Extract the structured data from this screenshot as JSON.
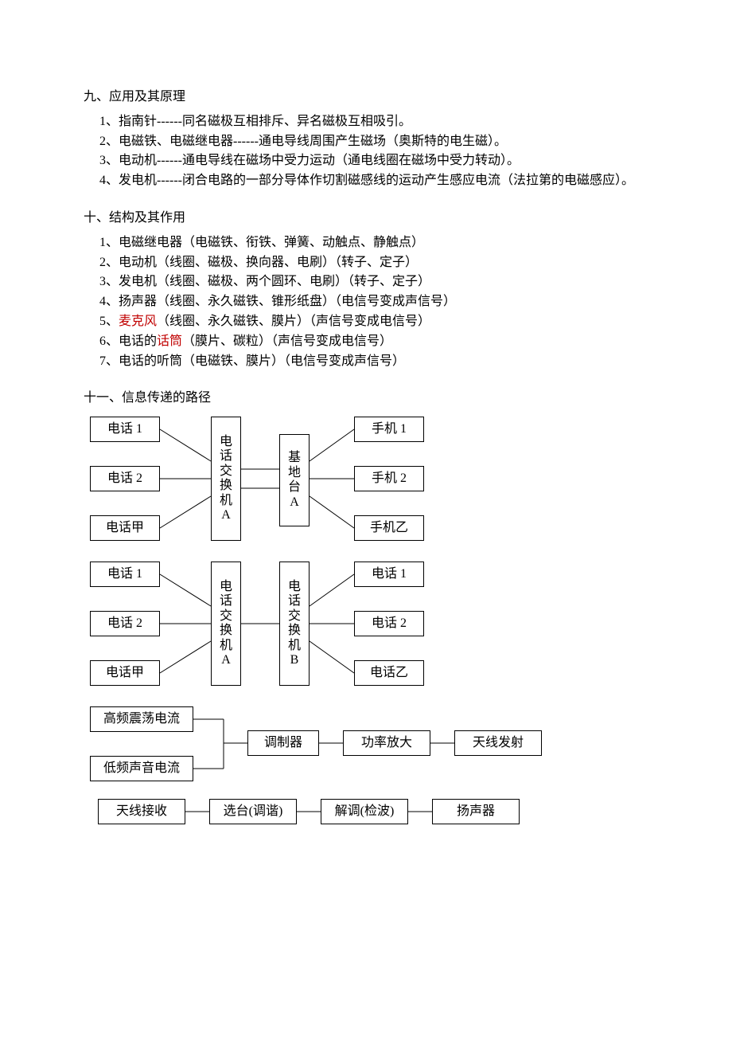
{
  "section9": {
    "title": "九、应用及其原理",
    "items": [
      "1、指南针------同名磁极互相排斥、异名磁极互相吸引。",
      "2、电磁铁、电磁继电器------通电导线周围产生磁场（奥斯特的电生磁）。",
      "3、电动机------通电导线在磁场中受力运动（通电线圈在磁场中受力转动）。",
      "4、发电机------闭合电路的一部分导体作切割磁感线的运动产生感应电流（法拉第的电磁感应）。"
    ]
  },
  "section10": {
    "title": "十、结构及其作用",
    "items": [
      {
        "pre": "1、电磁继电器（电磁铁、衔铁、弹簧、动触点、静触点）",
        "red": "",
        "post": ""
      },
      {
        "pre": "2、电动机（线圈、磁极、换向器、电刷）（转子、定子）",
        "red": "",
        "post": ""
      },
      {
        "pre": "3、发电机（线圈、磁极、两个圆环、电刷）（转子、定子）",
        "red": "",
        "post": ""
      },
      {
        "pre": "4、扬声器（线圈、永久磁铁、锥形纸盘）（电信号变成声信号）",
        "red": "",
        "post": ""
      },
      {
        "pre": "5、",
        "red": "麦克风",
        "post": "（线圈、永久磁铁、膜片）（声信号变成电信号）"
      },
      {
        "pre": "6、电话的",
        "red": "话筒",
        "post": "（膜片、碳粒）（声信号变成电信号）"
      },
      {
        "pre": "7、电话的听筒（电磁铁、膜片）（电信号变成声信号）",
        "red": "",
        "post": ""
      }
    ]
  },
  "section11": {
    "title": "十一、信息传递的路径"
  },
  "dg1": {
    "left": [
      "电话 1",
      "电话 2",
      "电话甲"
    ],
    "midA": "电\n话\n交\n换\n机\nA",
    "midB": "基\n地\n台\nA",
    "right": [
      "手机 1",
      "手机 2",
      "手机乙"
    ]
  },
  "dg2": {
    "left": [
      "电话 1",
      "电话 2",
      "电话甲"
    ],
    "midA": "电\n话\n交\n换\n机\nA",
    "midB": "电\n话\n交\n换\n机\nB",
    "right": [
      "电话 1",
      "电话 2",
      "电话乙"
    ]
  },
  "dg3": {
    "leftTop": "高频震荡电流",
    "leftBot": "低频声音电流",
    "mod": "调制器",
    "amp": "功率放大",
    "tx": "天线发射"
  },
  "dg4": {
    "a": "天线接收",
    "b": "选台(调谐)",
    "c": "解调(检波)",
    "d": "扬声器"
  }
}
